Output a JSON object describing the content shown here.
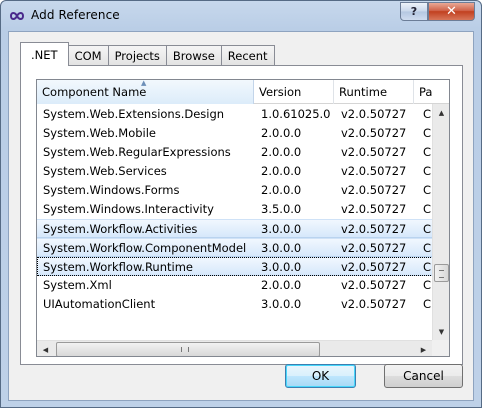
{
  "window": {
    "title": "Add Reference",
    "help_label": "?",
    "close_label": "✕"
  },
  "tabs": [
    {
      "label": ".NET",
      "active": true
    },
    {
      "label": "COM",
      "active": false
    },
    {
      "label": "Projects",
      "active": false
    },
    {
      "label": "Browse",
      "active": false
    },
    {
      "label": "Recent",
      "active": false
    }
  ],
  "list": {
    "columns": [
      "Component Name",
      "Version",
      "Runtime",
      "Pa"
    ],
    "sort_indicator": "▲",
    "rows": [
      {
        "name": "System.Web.Extensions.Design",
        "version": "1.0.61025.0",
        "runtime": "v2.0.50727",
        "path": "C"
      },
      {
        "name": "System.Web.Mobile",
        "version": "2.0.0.0",
        "runtime": "v2.0.50727",
        "path": "C"
      },
      {
        "name": "System.Web.RegularExpressions",
        "version": "2.0.0.0",
        "runtime": "v2.0.50727",
        "path": "C"
      },
      {
        "name": "System.Web.Services",
        "version": "2.0.0.0",
        "runtime": "v2.0.50727",
        "path": "C"
      },
      {
        "name": "System.Windows.Forms",
        "version": "2.0.0.0",
        "runtime": "v2.0.50727",
        "path": "C"
      },
      {
        "name": "System.Windows.Interactivity",
        "version": "3.5.0.0",
        "runtime": "v2.0.50727",
        "path": "C"
      },
      {
        "name": "System.Workflow.Activities",
        "version": "3.0.0.0",
        "runtime": "v2.0.50727",
        "path": "C",
        "selected": true
      },
      {
        "name": "System.Workflow.ComponentModel",
        "version": "3.0.0.0",
        "runtime": "v2.0.50727",
        "path": "C",
        "selected": true
      },
      {
        "name": "System.Workflow.Runtime",
        "version": "3.0.0.0",
        "runtime": "v2.0.50727",
        "path": "C",
        "selected": true,
        "focused": true
      },
      {
        "name": "System.Xml",
        "version": "2.0.0.0",
        "runtime": "v2.0.50727",
        "path": "C"
      },
      {
        "name": "UIAutomationClient",
        "version": "3.0.0.0",
        "runtime": "v2.0.50727",
        "path": "C"
      }
    ]
  },
  "scrollbars": {
    "up": "▲",
    "down": "▼",
    "left": "◀",
    "right": "▶"
  },
  "buttons": {
    "ok": "OK",
    "cancel": "Cancel"
  }
}
